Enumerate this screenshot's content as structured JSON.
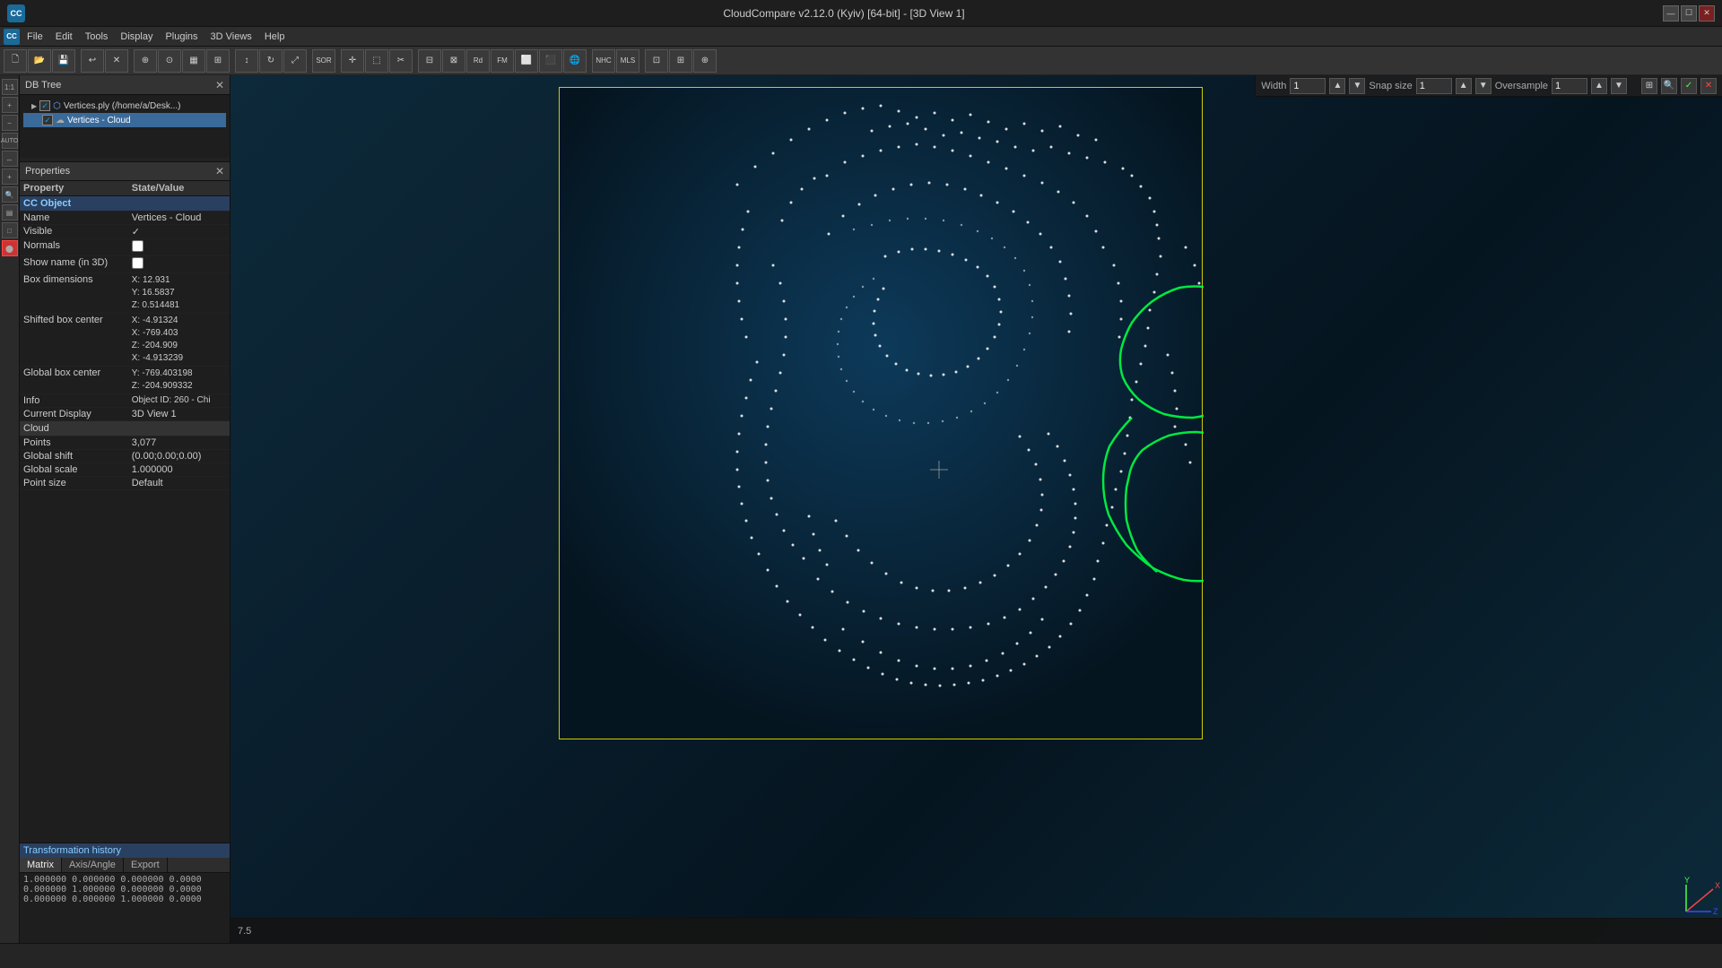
{
  "titleBar": {
    "title": "CloudCompare v2.12.0 (Kyiv) [64-bit] - [3D View 1]",
    "winControls": [
      "—",
      "☐",
      "✕"
    ]
  },
  "menuBar": {
    "items": [
      "CC",
      "File",
      "Edit",
      "Tools",
      "Display",
      "Plugins",
      "3D Views",
      "Help"
    ]
  },
  "dbTree": {
    "title": "DB Tree",
    "items": [
      {
        "label": "Vertices.ply (/home/a/Desk...",
        "indent": 0,
        "checked": true
      },
      {
        "label": "Vertices - Cloud",
        "indent": 1,
        "checked": true
      }
    ]
  },
  "properties": {
    "title": "Properties",
    "columns": [
      "Property",
      "State/Value"
    ],
    "sections": [
      {
        "name": "CC Object",
        "rows": [
          {
            "key": "Name",
            "value": "Vertices - Cloud"
          },
          {
            "key": "Visible",
            "value": "✓"
          },
          {
            "key": "Normals",
            "value": ""
          },
          {
            "key": "Show name (in 3D)",
            "value": ""
          }
        ]
      },
      {
        "name": "",
        "rows": [
          {
            "key": "Box dimensions",
            "value": "X: 12.931\nY: 16.5837\nZ: 0.514481"
          },
          {
            "key": "Shifted box center",
            "value": "X: -4.91324\n\nX: -769.403\nZ: -204.909\nX: -4.913239"
          },
          {
            "key": "Global box center",
            "value": "Y: -769.403198\nZ: -204.909332"
          },
          {
            "key": "Info",
            "value": "Object ID: 260 - Chi"
          },
          {
            "key": "Current Display",
            "value": "3D View 1"
          }
        ]
      },
      {
        "name": "Cloud",
        "rows": [
          {
            "key": "Points",
            "value": "3,077"
          },
          {
            "key": "Global shift",
            "value": "(0.00;0.00;0.00)"
          },
          {
            "key": "Global scale",
            "value": "1.000000"
          },
          {
            "key": "Point size",
            "value": "Default"
          }
        ]
      }
    ]
  },
  "transformHistory": {
    "title": "Transformation history",
    "tabs": [
      "Matrix",
      "Axis/Angle",
      "Export"
    ],
    "matrix": [
      "1.000000 0.000000 0.000000 0.0000",
      "0.000000 1.000000 0.000000 0.0000",
      "0.000000 0.000000 1.000000 0.0000"
    ]
  },
  "viewport": {
    "topBar": {
      "widthLabel": "Width",
      "widthValue": "1",
      "snapSizeLabel": "Snap size",
      "snapSizeValue": "1",
      "oversampleLabel": "Oversample",
      "oversampleValue": "1"
    },
    "bottomValue": "7.5"
  },
  "statusBar": {
    "items": []
  }
}
